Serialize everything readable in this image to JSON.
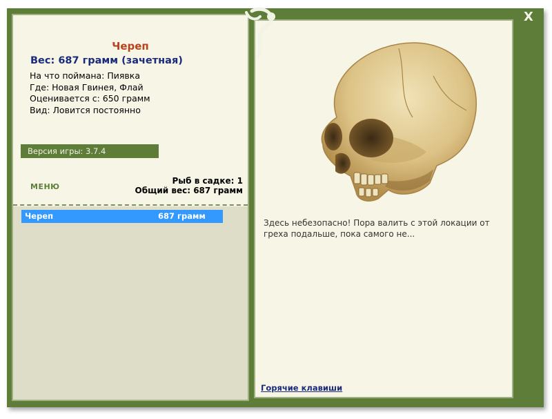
{
  "window": {
    "close_label": "X"
  },
  "fish": {
    "name": "Череп",
    "weight_line": "Вес: 687 грамм (зачетная)",
    "caught_on": "На что поймана: Пиявка",
    "location": "Где: Новая Гвинея, Флай",
    "valued_from": "Оценивается с: 650 грамм",
    "kind": "Вид: Ловится постоянно"
  },
  "version": "Версия игры: 3.7.4",
  "menu_label": "МЕНЮ",
  "stats": {
    "fish_count": "Рыб в садке: 1",
    "total_weight": "Общий вес: 687 грамм"
  },
  "catch_list": [
    {
      "name": "Череп",
      "weight": "687 грамм"
    }
  ],
  "description": "Здесь небезопасно! Пора валить с этой локации от греха подальше, пока самого не...",
  "hotkeys_label": "Горячие клавиши",
  "colors": {
    "frame": "#5e7d38",
    "panel": "#f6f5e6",
    "selected": "#3399ff"
  }
}
